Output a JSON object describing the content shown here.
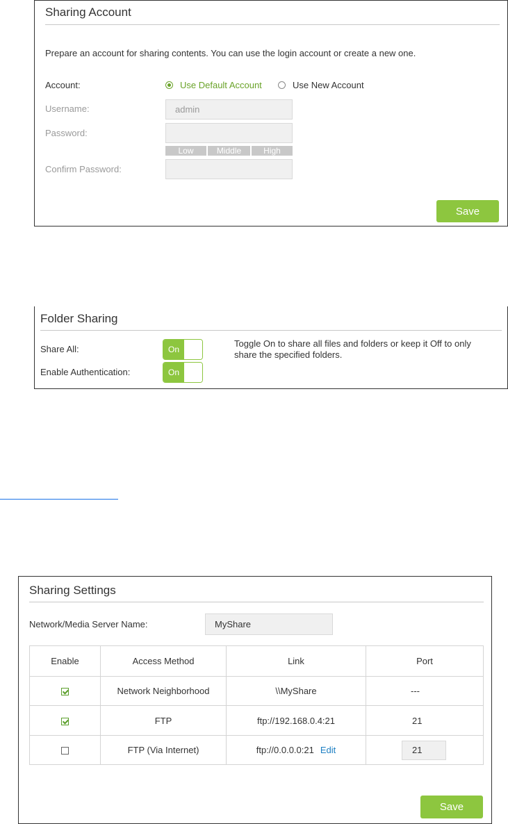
{
  "sharing_account": {
    "title": "Sharing Account",
    "description": "Prepare an account for sharing contents. You can use the login account or create a new one.",
    "account_label": "Account:",
    "option_default": "Use Default Account",
    "option_new": "Use New Account",
    "selected": "default",
    "username_label": "Username:",
    "username_value": "admin",
    "password_label": "Password:",
    "password_value": "",
    "strength": [
      "Low",
      "Middle",
      "High"
    ],
    "confirm_label": "Confirm Password:",
    "confirm_value": "",
    "save_label": "Save"
  },
  "folder_sharing": {
    "title": "Folder Sharing",
    "share_all_label": "Share All:",
    "share_all_state": "On",
    "auth_label": "Enable Authentication:",
    "auth_state": "On",
    "hint": "Toggle On to share all files and folders or keep it Off to only share the specified folders."
  },
  "sharing_settings": {
    "title": "Sharing Settings",
    "server_name_label": "Network/Media Server Name:",
    "server_name_value": "MyShare",
    "columns": [
      "Enable",
      "Access Method",
      "Link",
      "Port"
    ],
    "rows": [
      {
        "enabled": true,
        "method": "Network Neighborhood",
        "link": "\\\\MyShare",
        "port": "---"
      },
      {
        "enabled": true,
        "method": "FTP",
        "link": "ftp://192.168.0.4:21",
        "port": "21"
      },
      {
        "enabled": false,
        "method": "FTP (Via Internet)",
        "link": "ftp://0.0.0.0:21",
        "edit": "Edit",
        "port": "21"
      }
    ],
    "save_label": "Save"
  },
  "colors": {
    "accent": "#8dc63f",
    "link": "#1b7ec2",
    "radio_selected": "#6aa329"
  }
}
